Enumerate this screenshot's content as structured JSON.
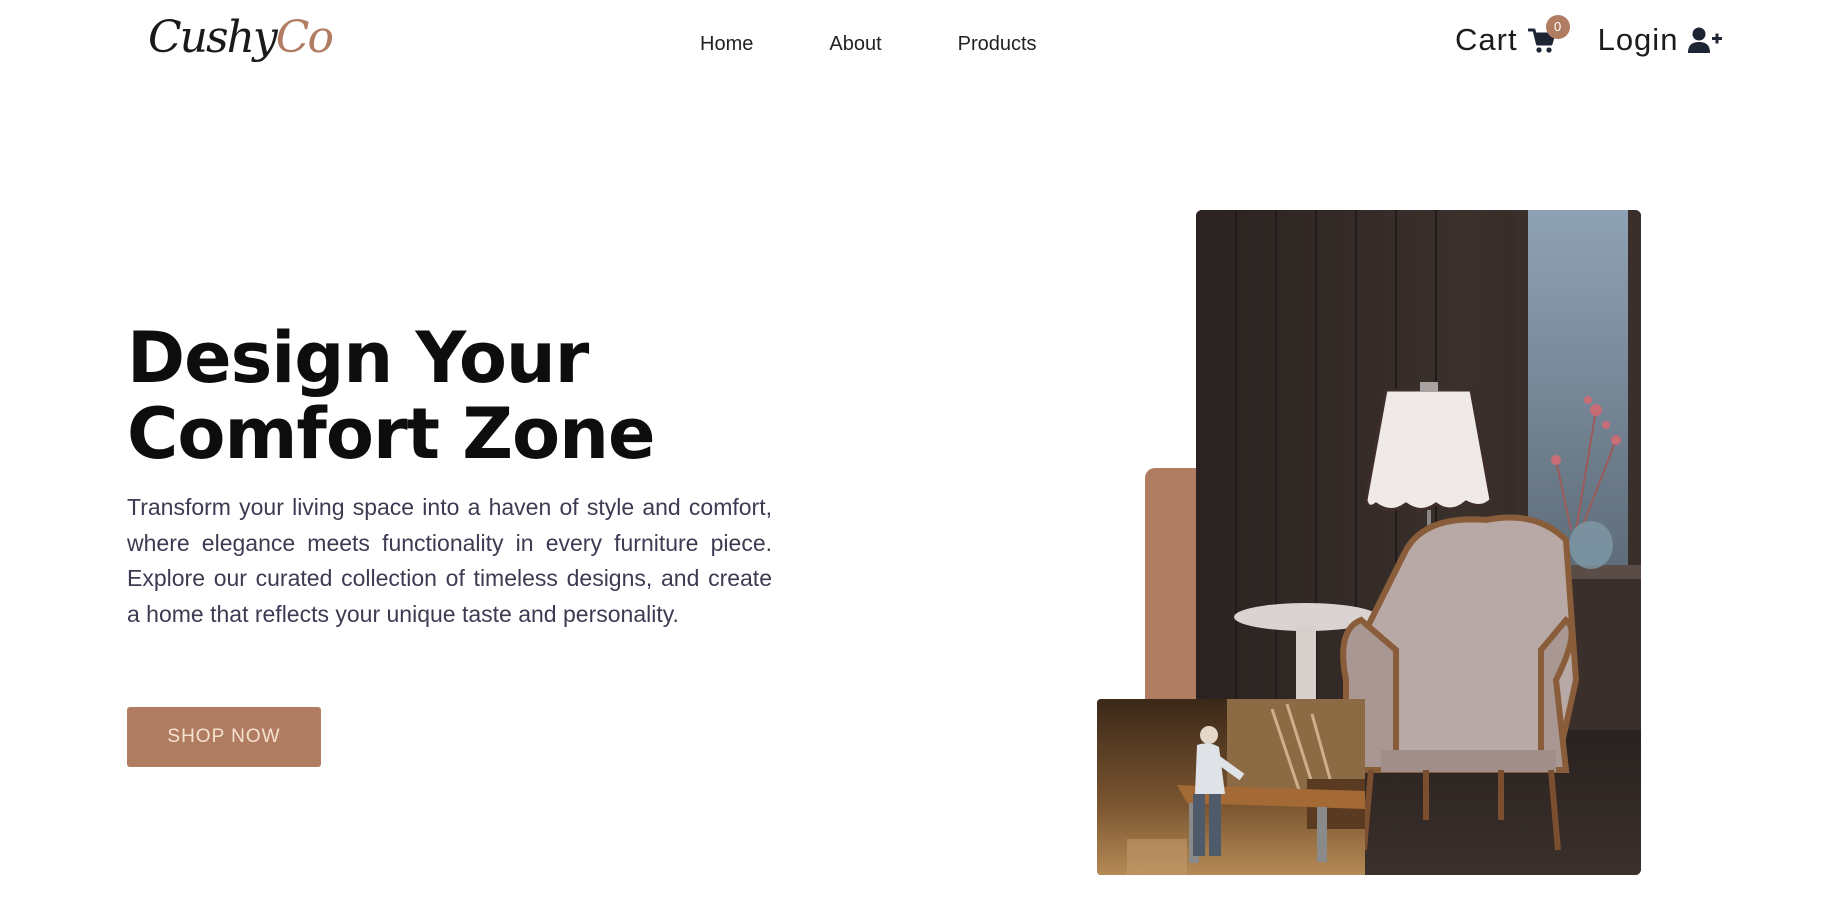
{
  "brand": {
    "logo_part1": "Cushy",
    "logo_part2": "Co",
    "accent_color": "#b07d62",
    "text_color": "#111111"
  },
  "nav": {
    "links": [
      {
        "label": "Home"
      },
      {
        "label": "About"
      },
      {
        "label": "Products"
      }
    ],
    "cart_label": "Cart",
    "cart_count": "0",
    "cart_icon": "shopping-cart-icon",
    "login_label": "Login",
    "login_icon": "user-plus-icon"
  },
  "hero": {
    "title_line1": "Design Your",
    "title_line2": "Comfort Zone",
    "description": "Transform your living space into a haven of style and comfort, where elegance meets functionality in every furniture piece. Explore our curated collection of timeless designs, and create a home that reflects your unique taste and personality.",
    "cta_label": "SHOP NOW"
  },
  "images": {
    "main": "armchair-with-lamp-photo",
    "secondary": "carpenter-workshop-photo"
  }
}
